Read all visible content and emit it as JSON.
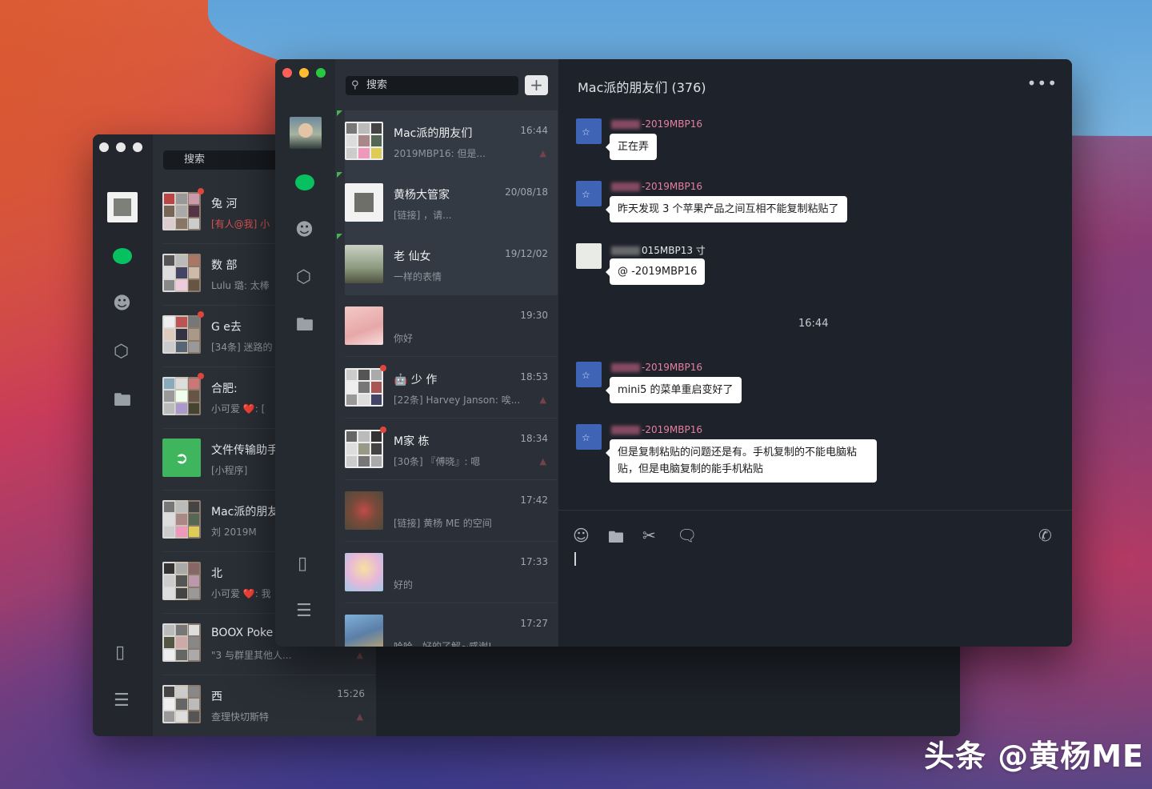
{
  "colors": {
    "accent_green": "#07c160",
    "mention_red": "#d9534f",
    "sender_pink": "#e87fa2"
  },
  "back_window": {
    "search_placeholder": "搜索",
    "sidebar_icons": [
      "avatar",
      "chat-bubble-icon",
      "contacts-icon",
      "box-icon",
      "folder-icon",
      "phone-icon",
      "menu-icon"
    ],
    "conversations": [
      {
        "name": "兔        河",
        "msg": "[有人@我] 小",
        "time": "",
        "alert": true
      },
      {
        "name": "数          部",
        "msg": "Lulu 璐: 太棒",
        "time": ""
      },
      {
        "name": "G        e去",
        "msg": "[34条] 迷路的",
        "time": ""
      },
      {
        "name": "合肥:",
        "msg": "小可爱 ❤️: [",
        "time": ""
      },
      {
        "name": "文件传输助手",
        "msg": "[小程序]",
        "time": ""
      },
      {
        "name": "Mac派的朋友",
        "msg": "刘        2019M",
        "time": ""
      },
      {
        "name": "北",
        "msg": "小可爱 ❤️: 我",
        "time": ""
      },
      {
        "name": "BOOX Poke",
        "msg": "\"3        与群里其他人...",
        "time": ""
      },
      {
        "name": "西",
        "msg": "查理快切斯特",
        "time": "15:26"
      }
    ]
  },
  "front_window": {
    "search_placeholder": "搜索",
    "plus_label": "+",
    "conversations": [
      {
        "name": "Mac派的朋友们",
        "msg": "        2019MBP16: 但是...",
        "time": "16:44",
        "muted": true
      },
      {
        "name": "黄杨大管家",
        "msg": "[链接]                ，请...",
        "time": "20/08/18"
      },
      {
        "name": "老          仙女",
        "msg": "一样的表情",
        "time": "19/12/02"
      },
      {
        "name": "",
        "msg": "你好",
        "time": "19:30"
      },
      {
        "name": "🤖 少                作",
        "msg": "[22条] Harvey Janson: 唉...",
        "time": "18:53",
        "muted": true
      },
      {
        "name": "M家             栋",
        "msg": "[30条] 『傅晓』: 嗯",
        "time": "18:34",
        "muted": true
      },
      {
        "name": "",
        "msg": "[链接] 黄杨 ME 的空间",
        "time": "17:42"
      },
      {
        "name": "",
        "msg": "好的",
        "time": "17:33"
      },
      {
        "name": "",
        "msg": "哈哈，好的了解~感谢!",
        "time": "17:27"
      }
    ],
    "chat": {
      "title": "Mac派的朋友们 (376)",
      "more_label": "•••",
      "messages": [
        {
          "sender": "-2019MBP16",
          "text": "正在弄"
        },
        {
          "sender": "-2019MBP16",
          "text": "昨天发现 3 个苹果产品之间互相不能复制粘贴了"
        },
        {
          "sender": "015MBP13 寸",
          "text": "@          -2019MBP16"
        },
        {
          "sender": "-2019MBP16",
          "text": "mini5 的菜单重启变好了"
        },
        {
          "sender": "-2019MBP16",
          "text": "但是复制粘贴的问题还是有。手机复制的不能电脑粘贴，但是电脑复制的能手机粘贴"
        }
      ],
      "time_separator": "16:44",
      "toolbar": [
        "emoji-icon",
        "folder-icon",
        "scissors-icon",
        "chat-icon",
        "phone-call-icon"
      ]
    }
  },
  "watermark": "头条 @黄杨ME"
}
